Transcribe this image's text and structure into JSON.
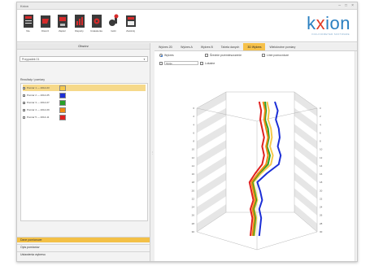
{
  "window": {
    "title": "Kxion",
    "controls": [
      "–",
      "□",
      "×"
    ]
  },
  "toolbar": {
    "buttons": [
      {
        "label": "Nie",
        "icon": "new-file-icon"
      },
      {
        "label": "Otwórz",
        "icon": "open-file-icon"
      },
      {
        "label": "Zapisz",
        "icon": "save-file-icon"
      },
      {
        "label": "Raporty",
        "icon": "report-icon"
      },
      {
        "label": "Ustawienia",
        "icon": "settings-icon"
      },
      {
        "label": "Gobi",
        "icon": "sensor-icon"
      },
      {
        "label": "Zamknij",
        "icon": "close-window-icon"
      }
    ]
  },
  "logo": {
    "prefix": "k",
    "mark": "x",
    "suffix": "ion",
    "tagline": "INCLINOMETER SOFTWARE"
  },
  "left_panel": {
    "header": "Otwórz",
    "select_value": "Przypadek 01",
    "series_section_label": "Rezultaty / pomiary",
    "series": [
      {
        "name": "Pomiar 1 — 2014-03",
        "color": "#f6c94a",
        "checked": true,
        "selected": true
      },
      {
        "name": "Pomiar 2 — 2014-05",
        "color": "#1c2fd6",
        "checked": true,
        "selected": false
      },
      {
        "name": "Pomiar 3 — 2014-07",
        "color": "#28a028",
        "checked": true,
        "selected": false
      },
      {
        "name": "Pomiar 4 — 2014-09",
        "color": "#f08a12",
        "checked": true,
        "selected": false
      },
      {
        "name": "Pomiar 5 — 2014-11",
        "color": "#e02020",
        "checked": false,
        "selected": false
      }
    ],
    "accordion": [
      "Dane pomiarowe",
      "Opis pomiarów",
      "Ustawienia wykresu"
    ]
  },
  "right_panel": {
    "tabs": [
      "Wykres 2D",
      "Wykres A",
      "Wykres B",
      "Tabela danych",
      "3D Wykres",
      "Wielokrotne pomiary"
    ],
    "active_tab": 4,
    "options": {
      "radio_1": "Wykres",
      "check_1": "Średnie przemieszczenie",
      "check_2": "Linie pomocnicze",
      "select_value": "Opcje",
      "check_3": "Lokalne"
    }
  },
  "chart_data": {
    "type": "line",
    "title": "",
    "xlabel": "",
    "ylabel": "",
    "zlabel": "",
    "depth_ticks": [
      "0",
      "2",
      "4",
      "6",
      "8",
      "10",
      "12",
      "14",
      "16",
      "18",
      "20",
      "22",
      "24",
      "26",
      "28",
      "30"
    ],
    "series": [
      {
        "name": "Pomiar 1",
        "color": "#f6c94a",
        "values": [
          0.32,
          0.34,
          0.33,
          0.36,
          0.37,
          0.35,
          0.38,
          0.36,
          0.26,
          0.18,
          0.2,
          0.22,
          0.19,
          0.21,
          0.2,
          0.19
        ]
      },
      {
        "name": "Pomiar 2",
        "color": "#1c2fd6",
        "values": [
          0.4,
          0.43,
          0.41,
          0.44,
          0.45,
          0.43,
          0.46,
          0.44,
          0.32,
          0.22,
          0.25,
          0.27,
          0.24,
          0.26,
          0.25,
          0.24
        ]
      },
      {
        "name": "Pomiar 3",
        "color": "#28a028",
        "values": [
          0.3,
          0.31,
          0.3,
          0.33,
          0.34,
          0.32,
          0.35,
          0.33,
          0.24,
          0.17,
          0.19,
          0.21,
          0.18,
          0.2,
          0.19,
          0.18
        ]
      },
      {
        "name": "Pomiar 4",
        "color": "#f08a12",
        "values": [
          0.28,
          0.3,
          0.29,
          0.31,
          0.33,
          0.31,
          0.33,
          0.31,
          0.23,
          0.16,
          0.18,
          0.2,
          0.17,
          0.19,
          0.18,
          0.17
        ]
      },
      {
        "name": "Pomiar 5",
        "color": "#e02020",
        "values": [
          0.24,
          0.26,
          0.25,
          0.27,
          0.29,
          0.27,
          0.29,
          0.27,
          0.2,
          0.14,
          0.16,
          0.18,
          0.15,
          0.17,
          0.16,
          0.15
        ]
      }
    ]
  }
}
